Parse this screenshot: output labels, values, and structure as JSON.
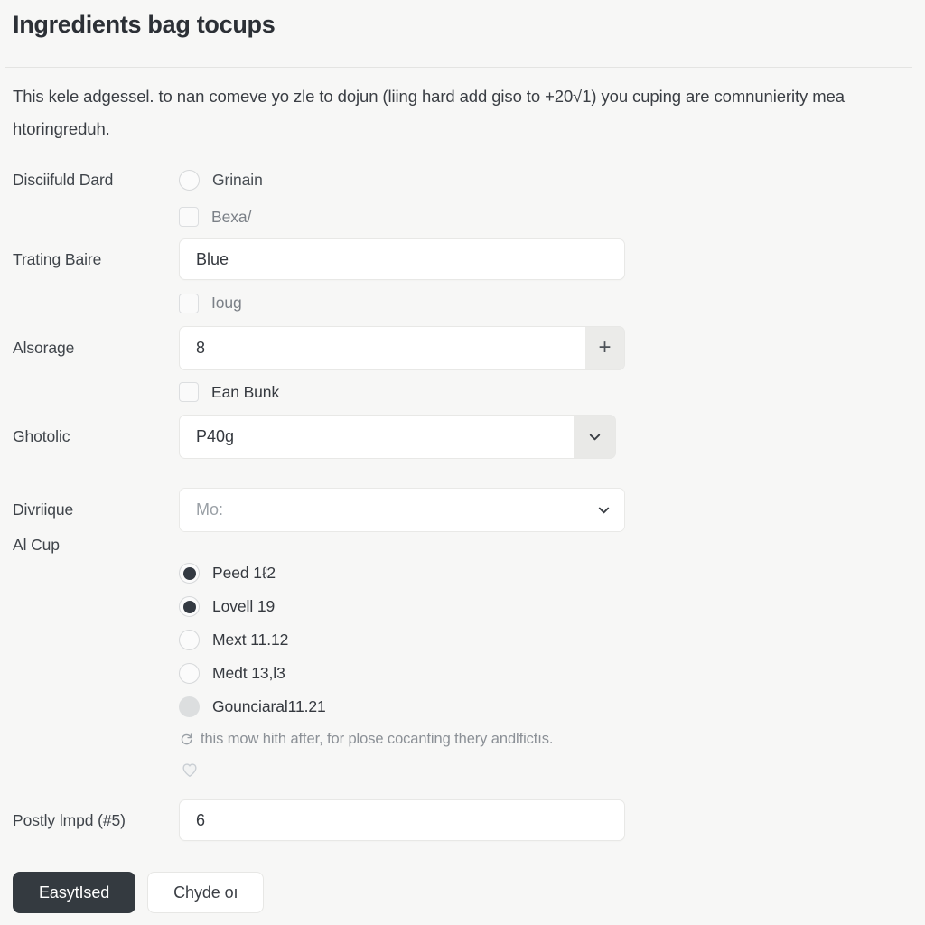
{
  "header": {
    "title": "Ingredients bag tocups",
    "description": "This kele adgessel. to nan comeve yo zle to dojun (liing hard add giso to +20√1) you cuping are comnunierity mea htoringreduh."
  },
  "form": {
    "rows": [
      {
        "label": "Disciifuld Dard",
        "control": "radio",
        "option_label": "Grinain",
        "checked": false
      },
      {
        "label": "",
        "control": "checkbox",
        "option_label": "Bexa/",
        "checked": false
      },
      {
        "label": "Trating Baire",
        "control": "text",
        "value": "Blue"
      },
      {
        "label": "",
        "control": "checkbox",
        "option_label": "Ioug",
        "checked": false
      },
      {
        "label": "Alsorage",
        "control": "stepper",
        "value": "8",
        "plus_label": "+"
      },
      {
        "label": "",
        "control": "checkbox",
        "option_label": "Ean Bunk",
        "checked": false
      },
      {
        "label": "Ghotolic",
        "control": "select",
        "value": "P40g"
      },
      {
        "label": "Divriique",
        "control": "select-placeholder",
        "placeholder": "Mo:"
      }
    ],
    "radio_group": {
      "label": "Al Cup",
      "options": [
        {
          "label": "Peed 1ℓ2",
          "state": "checked"
        },
        {
          "label": "Lovell 19",
          "state": "checked"
        },
        {
          "label": "Mext 11.12",
          "state": "unchecked"
        },
        {
          "label": "Medt 13,l3",
          "state": "unchecked"
        },
        {
          "label": "Gounciaral11.21",
          "state": "disabled"
        }
      ],
      "helper_text": "this mow hith after, for plose cocanting thery andlfictıs."
    },
    "bottom_row": {
      "label": "Postly lmpd (#5)",
      "value": "6"
    }
  },
  "actions": {
    "primary_label": "EasytIsed",
    "secondary_label": "Chyde oı"
  },
  "colors": {
    "background": "#f7f7f6",
    "primary_button": "#343a40",
    "text": "#30343a",
    "muted_text": "#8b9096",
    "border": "#e8e8e6",
    "field_background": "#ffffff",
    "addon_background": "#ebebe9"
  }
}
